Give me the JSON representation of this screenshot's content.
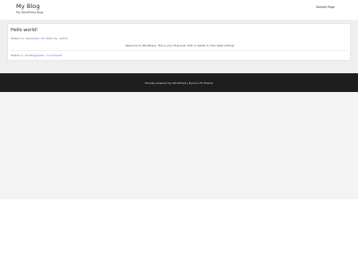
{
  "header": {
    "site_title": "My Blog",
    "tagline": "My WordPress Blog",
    "nav": [
      {
        "label": "Sample Page"
      }
    ]
  },
  "post": {
    "title": "Hello world!",
    "posted_on_label": "Posted on",
    "date": "December 13, 2020",
    "by_label": "by",
    "author": "admin",
    "content": "Welcome to WordPress. This is your first post. Edit or delete it, then start writing!",
    "posted_in_label": "Posted in",
    "category": "Uncategorized",
    "comments": "1 Comment"
  },
  "footer": {
    "text": "Proudly powered by WordPress | Ryocoo FX Theme"
  },
  "colors": {
    "link": "#4a74b8",
    "footer_bg": "#1e1e1e",
    "content_bg": "#efefef"
  }
}
